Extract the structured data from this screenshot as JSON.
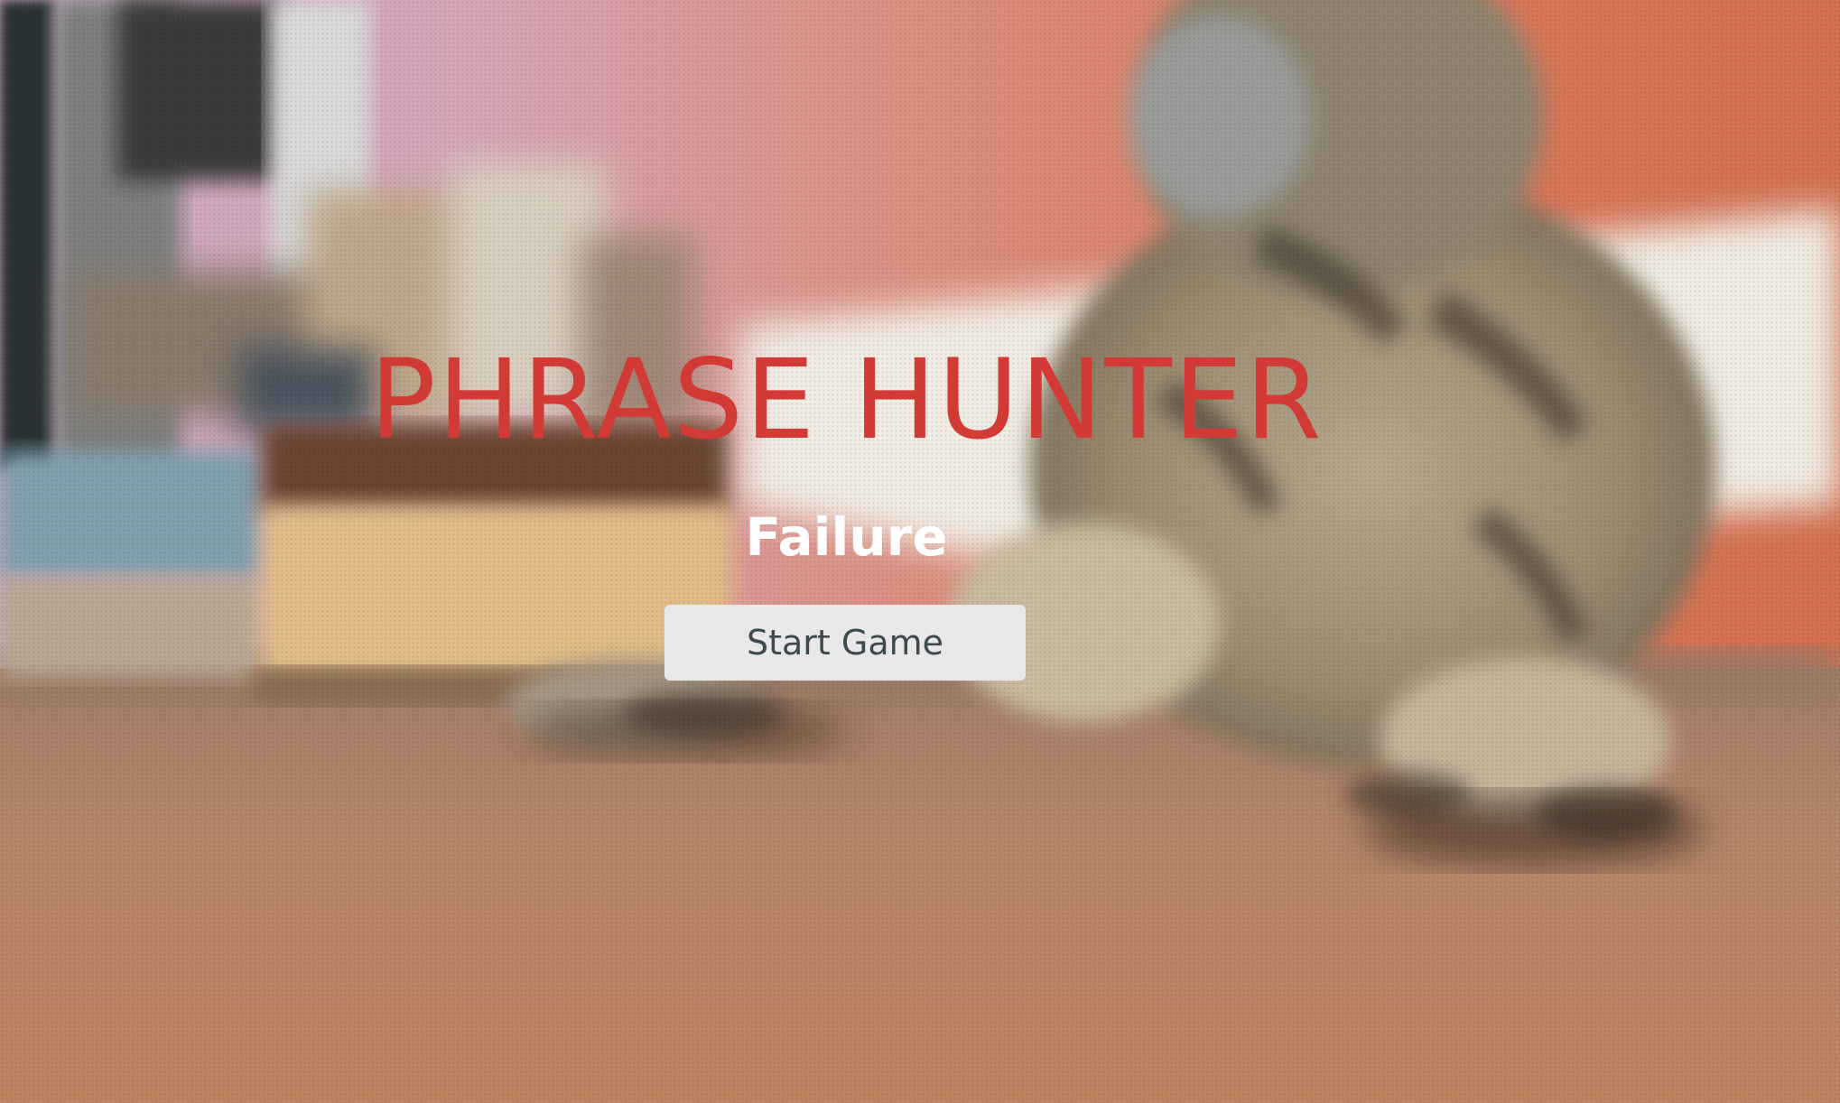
{
  "game": {
    "title": "PHRASE HUNTER",
    "status_message": "Failure",
    "start_button_label": "Start Game"
  },
  "colors": {
    "title": "#d23a35",
    "status_message": "#ffffff",
    "button_background": "#e8e8e9",
    "button_text": "#3c4a4f"
  },
  "background": {
    "subject": "blurred photo of a tabby cat lying on a wooden floor"
  }
}
